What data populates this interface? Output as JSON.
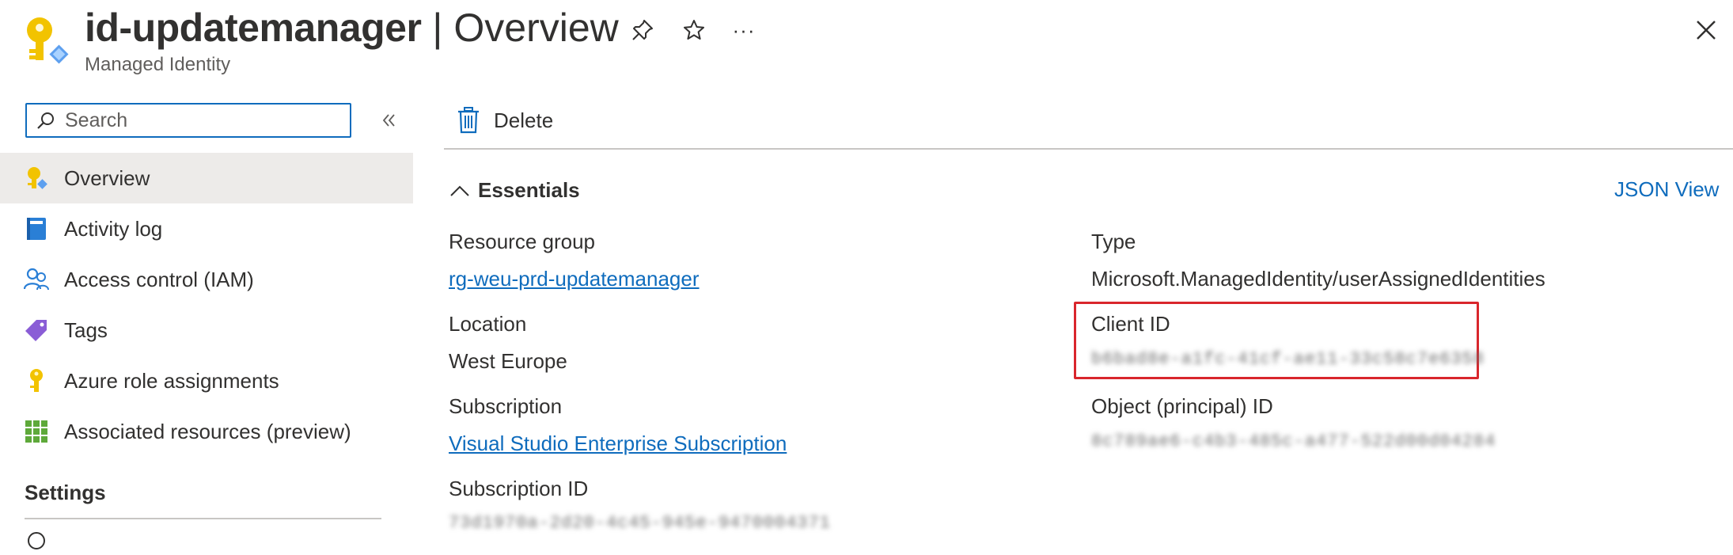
{
  "header": {
    "resource_name": "id-updatemanager",
    "separator": "|",
    "section": "Overview",
    "subtitle": "Managed Identity",
    "pin_icon": "pin-icon",
    "star_icon": "star-icon",
    "more_icon": "more-icon",
    "more_label": "···",
    "close_icon": "close-icon"
  },
  "sidebar": {
    "search_placeholder": "Search",
    "collapse_icon": "double-chevron-left-icon",
    "items": [
      {
        "label": "Overview",
        "icon": "managed-identity-icon",
        "active": true
      },
      {
        "label": "Activity log",
        "icon": "activity-log-icon",
        "active": false
      },
      {
        "label": "Access control (IAM)",
        "icon": "people-icon",
        "active": false
      },
      {
        "label": "Tags",
        "icon": "tag-icon",
        "active": false
      },
      {
        "label": "Azure role assignments",
        "icon": "key-icon",
        "active": false
      },
      {
        "label": "Associated resources (preview)",
        "icon": "grid-icon",
        "active": false
      }
    ],
    "settings_heading": "Settings"
  },
  "toolbar": {
    "delete_label": "Delete",
    "delete_icon": "trash-icon"
  },
  "essentials": {
    "heading": "Essentials",
    "json_view": "JSON View",
    "left": {
      "resource_group_label": "Resource group",
      "resource_group_value": "rg-weu-prd-updatemanager",
      "location_label": "Location",
      "location_value": "West Europe",
      "subscription_label": "Subscription",
      "subscription_value": "Visual Studio Enterprise Subscription",
      "subscription_id_label": "Subscription ID",
      "subscription_id_value": "73d1970a-2d20-4c45-945e-9470004371"
    },
    "right": {
      "type_label": "Type",
      "type_value": "Microsoft.ManagedIdentity/userAssignedIdentities",
      "client_id_label": "Client ID",
      "client_id_value": "b6bad8e-a1fc-41cf-ae11-33c58c7e6358",
      "object_id_label": "Object (principal) ID",
      "object_id_value": "8c789ae6-c4b3-485c-a477-522d00d04284"
    }
  },
  "colors": {
    "accent": "#0f6cbd",
    "highlight": "#d9262c",
    "active_nav": "#edebe9"
  }
}
